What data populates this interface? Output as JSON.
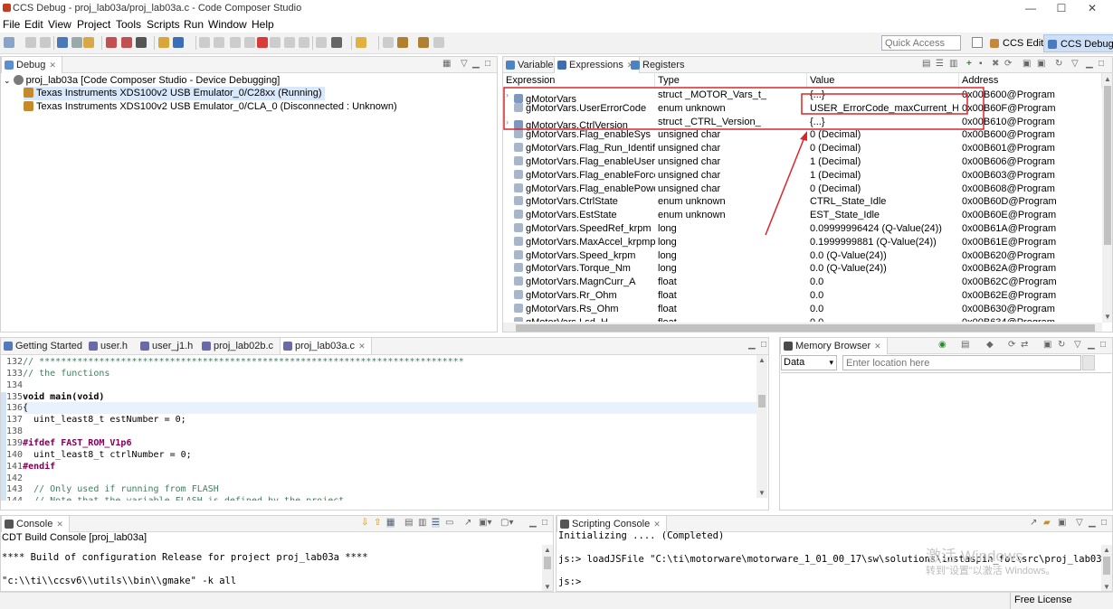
{
  "window": {
    "title": "CCS Debug - proj_lab03a/proj_lab03a.c - Code Composer Studio",
    "minimize": "—",
    "maximize": "☐",
    "close": "✕"
  },
  "menu": [
    "File",
    "Edit",
    "View",
    "Project",
    "Tools",
    "Scripts",
    "Run",
    "Window",
    "Help"
  ],
  "toolbar": {
    "quick_access_placeholder": "Quick Access",
    "perspectives": [
      "CCS Edit",
      "CCS Debug"
    ],
    "active_perspective": "CCS Debug"
  },
  "debug_view": {
    "tab": "Debug",
    "tree": [
      {
        "label": "proj_lab03a [Code Composer Studio - Device Debugging]",
        "level": 0
      },
      {
        "label": "Texas Instruments XDS100v2 USB Emulator_0/C28xx (Running)",
        "level": 1,
        "selected": true
      },
      {
        "label": "Texas Instruments XDS100v2 USB Emulator_0/CLA_0 (Disconnected : Unknown)",
        "level": 1
      }
    ]
  },
  "expressions_view": {
    "tabs": [
      "Variables",
      "Expressions",
      "Registers"
    ],
    "active_tab": "Expressions",
    "columns": [
      "Expression",
      "Type",
      "Value",
      "Address"
    ],
    "rows": [
      {
        "expression": "gMotorVars",
        "type": "struct _MOTOR_Vars_t_",
        "value": "{...}",
        "address": "0x00B600@Program",
        "expandable": true
      },
      {
        "expression": "gMotorVars.UserErrorCode",
        "type": "enum unknown",
        "value": "USER_ErrorCode_maxCurrent_High",
        "address": "0x00B60F@Program",
        "expandable": false
      },
      {
        "expression": "gMotorVars.CtrlVersion",
        "type": "struct _CTRL_Version_",
        "value": "{...}",
        "address": "0x00B610@Program",
        "expandable": true
      },
      {
        "expression": "gMotorVars.Flag_enableSys",
        "type": "unsigned char",
        "value": "0 (Decimal)",
        "address": "0x00B600@Program",
        "expandable": false
      },
      {
        "expression": "gMotorVars.Flag_Run_Identify",
        "type": "unsigned char",
        "value": "0 (Decimal)",
        "address": "0x00B601@Program",
        "expandable": false
      },
      {
        "expression": "gMotorVars.Flag_enableUserF",
        "type": "unsigned char",
        "value": "1 (Decimal)",
        "address": "0x00B606@Program",
        "expandable": false
      },
      {
        "expression": "gMotorVars.Flag_enableForce",
        "type": "unsigned char",
        "value": "1 (Decimal)",
        "address": "0x00B603@Program",
        "expandable": false
      },
      {
        "expression": "gMotorVars.Flag_enablePowe",
        "type": "unsigned char",
        "value": "0 (Decimal)",
        "address": "0x00B608@Program",
        "expandable": false
      },
      {
        "expression": "gMotorVars.CtrlState",
        "type": "enum unknown",
        "value": "CTRL_State_Idle",
        "address": "0x00B60D@Program",
        "expandable": false
      },
      {
        "expression": "gMotorVars.EstState",
        "type": "enum unknown",
        "value": "EST_State_Idle",
        "address": "0x00B60E@Program",
        "expandable": false
      },
      {
        "expression": "gMotorVars.SpeedRef_krpm",
        "type": "long",
        "value": "0.09999996424 (Q-Value(24))",
        "address": "0x00B61A@Program",
        "expandable": false
      },
      {
        "expression": "gMotorVars.MaxAccel_krpmp",
        "type": "long",
        "value": "0.1999999881 (Q-Value(24))",
        "address": "0x00B61E@Program",
        "expandable": false
      },
      {
        "expression": "gMotorVars.Speed_krpm",
        "type": "long",
        "value": "0.0 (Q-Value(24))",
        "address": "0x00B620@Program",
        "expandable": false
      },
      {
        "expression": "gMotorVars.Torque_Nm",
        "type": "long",
        "value": "0.0 (Q-Value(24))",
        "address": "0x00B62A@Program",
        "expandable": false
      },
      {
        "expression": "gMotorVars.MagnCurr_A",
        "type": "float",
        "value": "0.0",
        "address": "0x00B62C@Program",
        "expandable": false
      },
      {
        "expression": "gMotorVars.Rr_Ohm",
        "type": "float",
        "value": "0.0",
        "address": "0x00B62E@Program",
        "expandable": false
      },
      {
        "expression": "gMotorVars.Rs_Ohm",
        "type": "float",
        "value": "0.0",
        "address": "0x00B630@Program",
        "expandable": false
      },
      {
        "expression": "gMotorVars.Lsd_H",
        "type": "float",
        "value": "0.0",
        "address": "0x00B634@Program",
        "expandable": false
      }
    ]
  },
  "editor": {
    "tabs": [
      "Getting Started",
      "user.h",
      "user_j1.h",
      "proj_lab02b.c",
      "proj_lab03a.c"
    ],
    "active_tab": "proj_lab03a.c",
    "lines": [
      {
        "num": "132",
        "text": "// ******************************************************************************",
        "kind": "comment"
      },
      {
        "num": "133",
        "text": "// the functions",
        "kind": "comment"
      },
      {
        "num": "134",
        "text": "",
        "kind": "plain"
      },
      {
        "num": "135",
        "text": "void main(void)",
        "kind": "func"
      },
      {
        "num": "136",
        "text": "{",
        "kind": "plain",
        "current": true
      },
      {
        "num": "137",
        "text": "  uint_least8_t estNumber = 0;",
        "kind": "plain"
      },
      {
        "num": "138",
        "text": "",
        "kind": "plain"
      },
      {
        "num": "139",
        "text": "#ifdef FAST_ROM_V1p6",
        "kind": "pp"
      },
      {
        "num": "140",
        "text": "  uint_least8_t ctrlNumber = 0;",
        "kind": "plain"
      },
      {
        "num": "141",
        "text": "#endif",
        "kind": "pp"
      },
      {
        "num": "142",
        "text": "",
        "kind": "plain"
      },
      {
        "num": "143",
        "text": "  // Only used if running from FLASH",
        "kind": "comment"
      },
      {
        "num": "144",
        "text": "  // Note that the variable FLASH is defined by the project",
        "kind": "comment"
      }
    ]
  },
  "memory_browser": {
    "tab": "Memory Browser",
    "type_select": "Data",
    "location_placeholder": "Enter location here"
  },
  "console": {
    "tab": "Console",
    "subtitle": "CDT Build Console [proj_lab03a]",
    "lines": [
      "**** Build of configuration Release for project proj_lab03a ****",
      "",
      "\"c:\\\\ti\\\\ccsv6\\\\utils\\\\bin\\\\gmake\" -k all"
    ]
  },
  "scripting_console": {
    "tab": "Scripting Console",
    "lines": [
      "Initializing .... (Completed)",
      "",
      "js:> loadJSFile \"C:\\ti\\motorware\\motorware_1_01_00_17\\sw\\solutions\\instaspin_foc\\src\\proj_lab03a.js\"",
      "",
      "js:>"
    ]
  },
  "watermark": {
    "line1": "激活 Windows",
    "line2": "转到\"设置\"以激活 Windows。"
  },
  "status": {
    "license": "Free License"
  },
  "annotation_color": "#d9262c"
}
